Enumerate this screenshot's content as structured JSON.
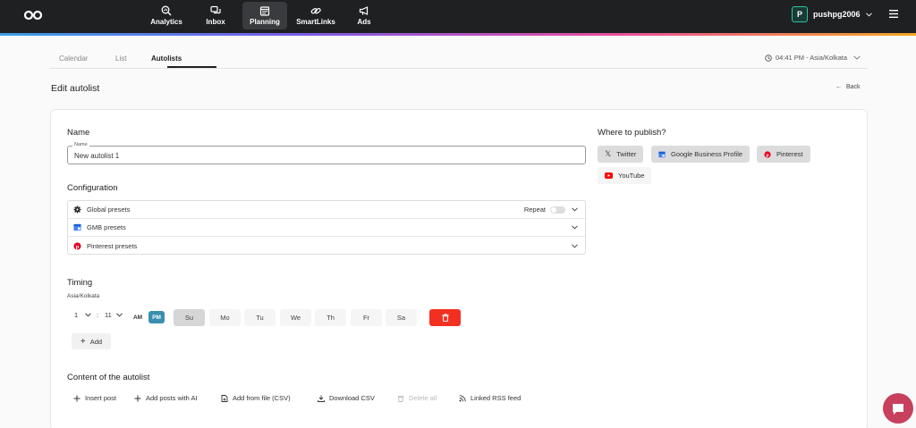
{
  "nav": {
    "items": [
      {
        "label": "Analytics",
        "icon": "magnifier-chart-icon"
      },
      {
        "label": "Inbox",
        "icon": "chat-bubbles-icon"
      },
      {
        "label": "Planning",
        "icon": "calendar-icon",
        "active": true
      },
      {
        "label": "SmartLinks",
        "icon": "link-icon"
      },
      {
        "label": "Ads",
        "icon": "megaphone-icon"
      }
    ],
    "user": {
      "avatar_letter": "P",
      "username": "pushpg2006"
    }
  },
  "tabs": [
    "Calendar",
    "List",
    "Autolists"
  ],
  "timezone_display": "04:41 PM - Asia/Kolkata",
  "page": {
    "title": "Edit autolist",
    "back_label": "Back"
  },
  "name_section": {
    "title": "Name",
    "field_label": "Name",
    "value": "New autolist 1"
  },
  "configuration": {
    "title": "Configuration",
    "rows": [
      {
        "label": "Global presets",
        "icon": "gear-icon"
      },
      {
        "label": "GMB presets",
        "icon": "gmb-icon"
      },
      {
        "label": "Pinterest presets",
        "icon": "pinterest-icon"
      }
    ],
    "repeat_label": "Repeat"
  },
  "timing": {
    "title": "Timing",
    "timezone": "Asia/Kolkata",
    "hour": "1",
    "separator": ":",
    "minute": "11",
    "am": "AM",
    "pm": "PM",
    "days": [
      "Su",
      "Mo",
      "Tu",
      "We",
      "Th",
      "Fr",
      "Sa"
    ],
    "selected_day": "Su",
    "add_label": "Add"
  },
  "content": {
    "title": "Content of the autolist",
    "actions": [
      {
        "label": "Insert post",
        "icon": "plus-icon",
        "enabled": true
      },
      {
        "label": "Add posts with AI",
        "icon": "plus-icon",
        "enabled": true
      },
      {
        "label": "Add from file (CSV)",
        "icon": "file-add-icon",
        "enabled": true
      },
      {
        "label": "Download CSV",
        "icon": "download-icon",
        "enabled": true
      },
      {
        "label": "Delete all",
        "icon": "trash-icon",
        "enabled": false
      },
      {
        "label": "Linked RSS feed",
        "icon": "rss-icon",
        "enabled": true
      }
    ]
  },
  "publish": {
    "title": "Where to publish?",
    "targets": [
      {
        "label": "Twitter",
        "icon": "x-icon",
        "selected": true
      },
      {
        "label": "Google Business Profile",
        "icon": "gmb-icon",
        "selected": true
      },
      {
        "label": "Pinterest",
        "icon": "pinterest-icon",
        "selected": true
      },
      {
        "label": "YouTube",
        "icon": "youtube-icon",
        "selected": false
      }
    ]
  },
  "colors": {
    "topbar": "#1f2022",
    "accent": "#2ec4a5",
    "pm": "#3a8fb0",
    "delete": "#f23022",
    "chat": "#c7405d"
  }
}
